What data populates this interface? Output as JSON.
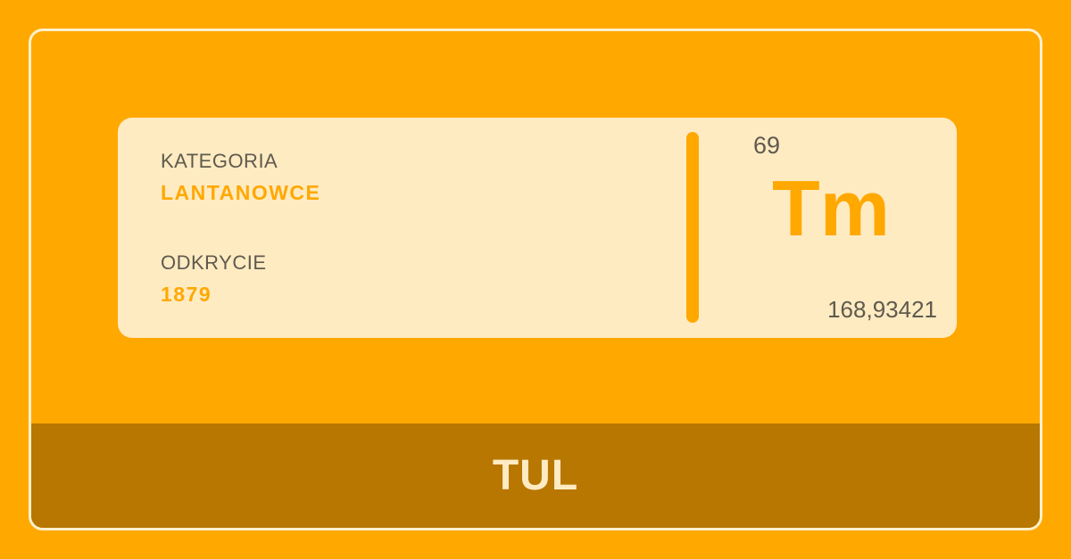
{
  "colors": {
    "background": "#FFA800",
    "card": "#FFEBC2",
    "accent": "#FFA800",
    "footer": "#B77700",
    "text_dark": "#5F5A4E"
  },
  "element": {
    "category_label": "KATEGORIA",
    "category_value": "LANTANOWCE",
    "discovery_label": "ODKRYCIE",
    "discovery_value": "1879",
    "atomic_number": "69",
    "symbol": "Tm",
    "atomic_mass": "168,93421",
    "name": "TUL"
  }
}
